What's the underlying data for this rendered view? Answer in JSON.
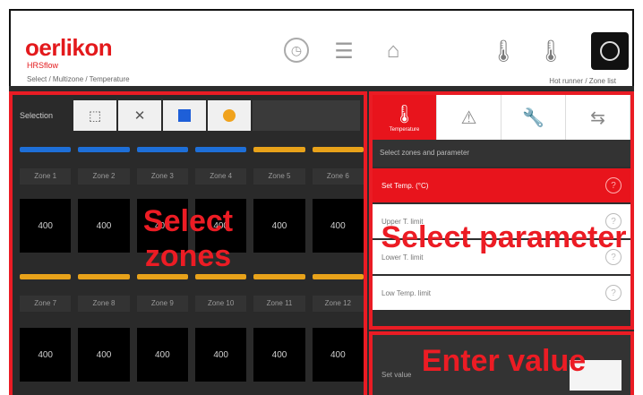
{
  "header": {
    "logo": "oerlikon",
    "logo_sub": "HRSflow",
    "breadcrumb": "Select / Multizone / Temperature",
    "right_text": "Hot runner / Zone list"
  },
  "selection": {
    "label": "Selection",
    "options": [
      "all-icon",
      "none-icon",
      "blue-group",
      "orange-group"
    ]
  },
  "zones_top": {
    "colors": [
      "#1e6fd8",
      "#1e6fd8",
      "#1e6fd8",
      "#1e6fd8",
      "#e8a21a",
      "#e8a21a"
    ],
    "names": [
      "Zone 1",
      "Zone 2",
      "Zone 3",
      "Zone 4",
      "Zone 5",
      "Zone 6"
    ],
    "values": [
      "400",
      "400",
      "400",
      "400",
      "400",
      "400"
    ]
  },
  "zones_bottom": {
    "colors": [
      "#e8a21a",
      "#e8a21a",
      "#e8a21a",
      "#e8a21a",
      "#e8a21a",
      "#e8a21a"
    ],
    "names": [
      "Zone 7",
      "Zone 8",
      "Zone 9",
      "Zone 10",
      "Zone 11",
      "Zone 12"
    ],
    "values": [
      "400",
      "400",
      "400",
      "400",
      "400",
      "400"
    ]
  },
  "params": {
    "tabs": [
      "Temperature",
      "Alarm",
      "Settings",
      "Mode"
    ],
    "hint": "Select zones and parameter",
    "rows": [
      "Set Temp. (°C)",
      "Upper T. limit",
      "Lower T. limit",
      "Low Temp. limit"
    ]
  },
  "value": {
    "label": "Set value"
  },
  "annotations": {
    "select_zones": "Select zones",
    "select_parameter": "Select parameter",
    "enter_value": "Enter value"
  },
  "colors": {
    "accent": "#ea1c24",
    "blue": "#1e6fd8",
    "orange": "#e8a21a"
  }
}
